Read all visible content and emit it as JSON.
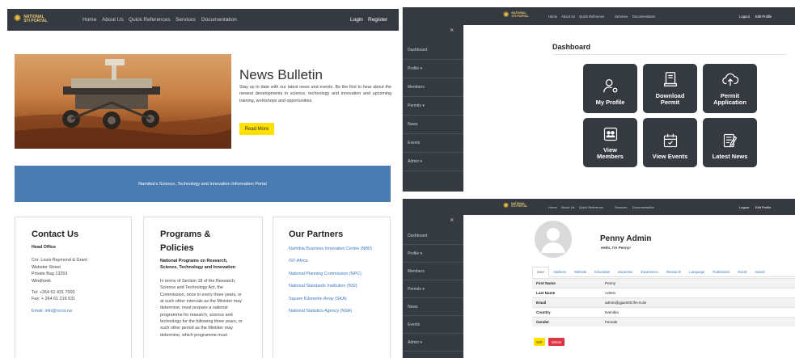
{
  "brand": {
    "name_line1": "NATIONAL",
    "name_line2": "STI PORTAL"
  },
  "left": {
    "nav": {
      "home": "Home",
      "about": "About Us",
      "quick": "Quick References",
      "services": "Services",
      "docs": "Documentation",
      "login": "Login",
      "register": "Register"
    },
    "news": {
      "title": "News Bulletin",
      "body": "Stay up to date with our latest news and events. Be the first to hear about the newest developments in science, technology and innovation and upcoming training, workshops and opportunities.",
      "button": "Read More"
    },
    "banner": "Namibia's Science, Technology and Innovation Information Portal",
    "contact": {
      "title": "Contact Us",
      "office": "Head Office",
      "address": [
        "Cnr. Louis Raymond & Grant",
        "Webster Street",
        "Private Bag 13253",
        "Windhoek"
      ],
      "tel": "Tel: +264 61 431 7000",
      "fax": "Fax: + 264 61 216 531",
      "email": "Email: info@ncrst.na"
    },
    "programs": {
      "title": "Programs & Policies",
      "subtitle": "National Programs on Research, Science, Technology and Innovation",
      "body": "In terms of Section 18 of the Research, Science and Technology Act, the Commission, once in every three years, or at such other intervals as the Minister may determine, must prepare a national programme for research, science and technology for the following three years, or such other period as the Minister may determine, which programme must"
    },
    "partners": {
      "title": "Our Partners",
      "items": [
        "Namibia Business Innovation Centre (NBII)",
        "IST-Africa",
        "National Planning Commission (NPC)",
        "National Standards Institution (NSI)",
        "Square Kilometre Array (SKA)",
        "National Statistics Agency (NSA)"
      ]
    }
  },
  "dashboard": {
    "nav": {
      "home": "Home",
      "about": "About Us",
      "quick": "Quick Reference",
      "services": "Services",
      "docs": "Documentation",
      "logout": "Logout",
      "edit": "Edit Profile"
    },
    "close": "×",
    "sidebar": [
      "Dashboard",
      "Profile ▾",
      "Members",
      "Permits ▾",
      "News",
      "Events",
      "Admin ▾"
    ],
    "heading": "Dashboard",
    "tiles": [
      {
        "label": "My Profile",
        "icon": "user-gear-icon"
      },
      {
        "label": "Download Permit",
        "icon": "download-document-icon"
      },
      {
        "label": "Permit Application",
        "icon": "cloud-upload-icon"
      },
      {
        "label": "View Members",
        "icon": "members-icon"
      },
      {
        "label": "View Events",
        "icon": "calendar-icon"
      },
      {
        "label": "Latest News",
        "icon": "news-icon"
      }
    ]
  },
  "profile": {
    "nav": {
      "home": "Home",
      "about": "About Us",
      "quick": "Quick Reference",
      "services": "Services",
      "docs": "Documentation",
      "logout": "Logout",
      "edit": "Edit Profile"
    },
    "close": "×",
    "sidebar": [
      "Dashboard",
      "Profile ▾",
      "Members",
      "Permits ▾",
      "News",
      "Events",
      "Admin ▾"
    ],
    "name": "Penny Admin",
    "greeting": "Hello, I'm Penny!",
    "tabs": [
      "User",
      "Address",
      "Website",
      "Education",
      "Expertise",
      "Experience",
      "Research",
      "Language",
      "Publication",
      "Event",
      "Award"
    ],
    "rows": [
      {
        "label": "First Name",
        "value": "Penny"
      },
      {
        "label": "Last Name",
        "value": "Admin"
      },
      {
        "label": "Email",
        "value": "admin@gjax000.lhn-6.de"
      },
      {
        "label": "Country",
        "value": "Namibia"
      },
      {
        "label": "Gender",
        "value": "Female"
      }
    ],
    "edit_btn": "Edit",
    "delete_btn": "Delete"
  }
}
